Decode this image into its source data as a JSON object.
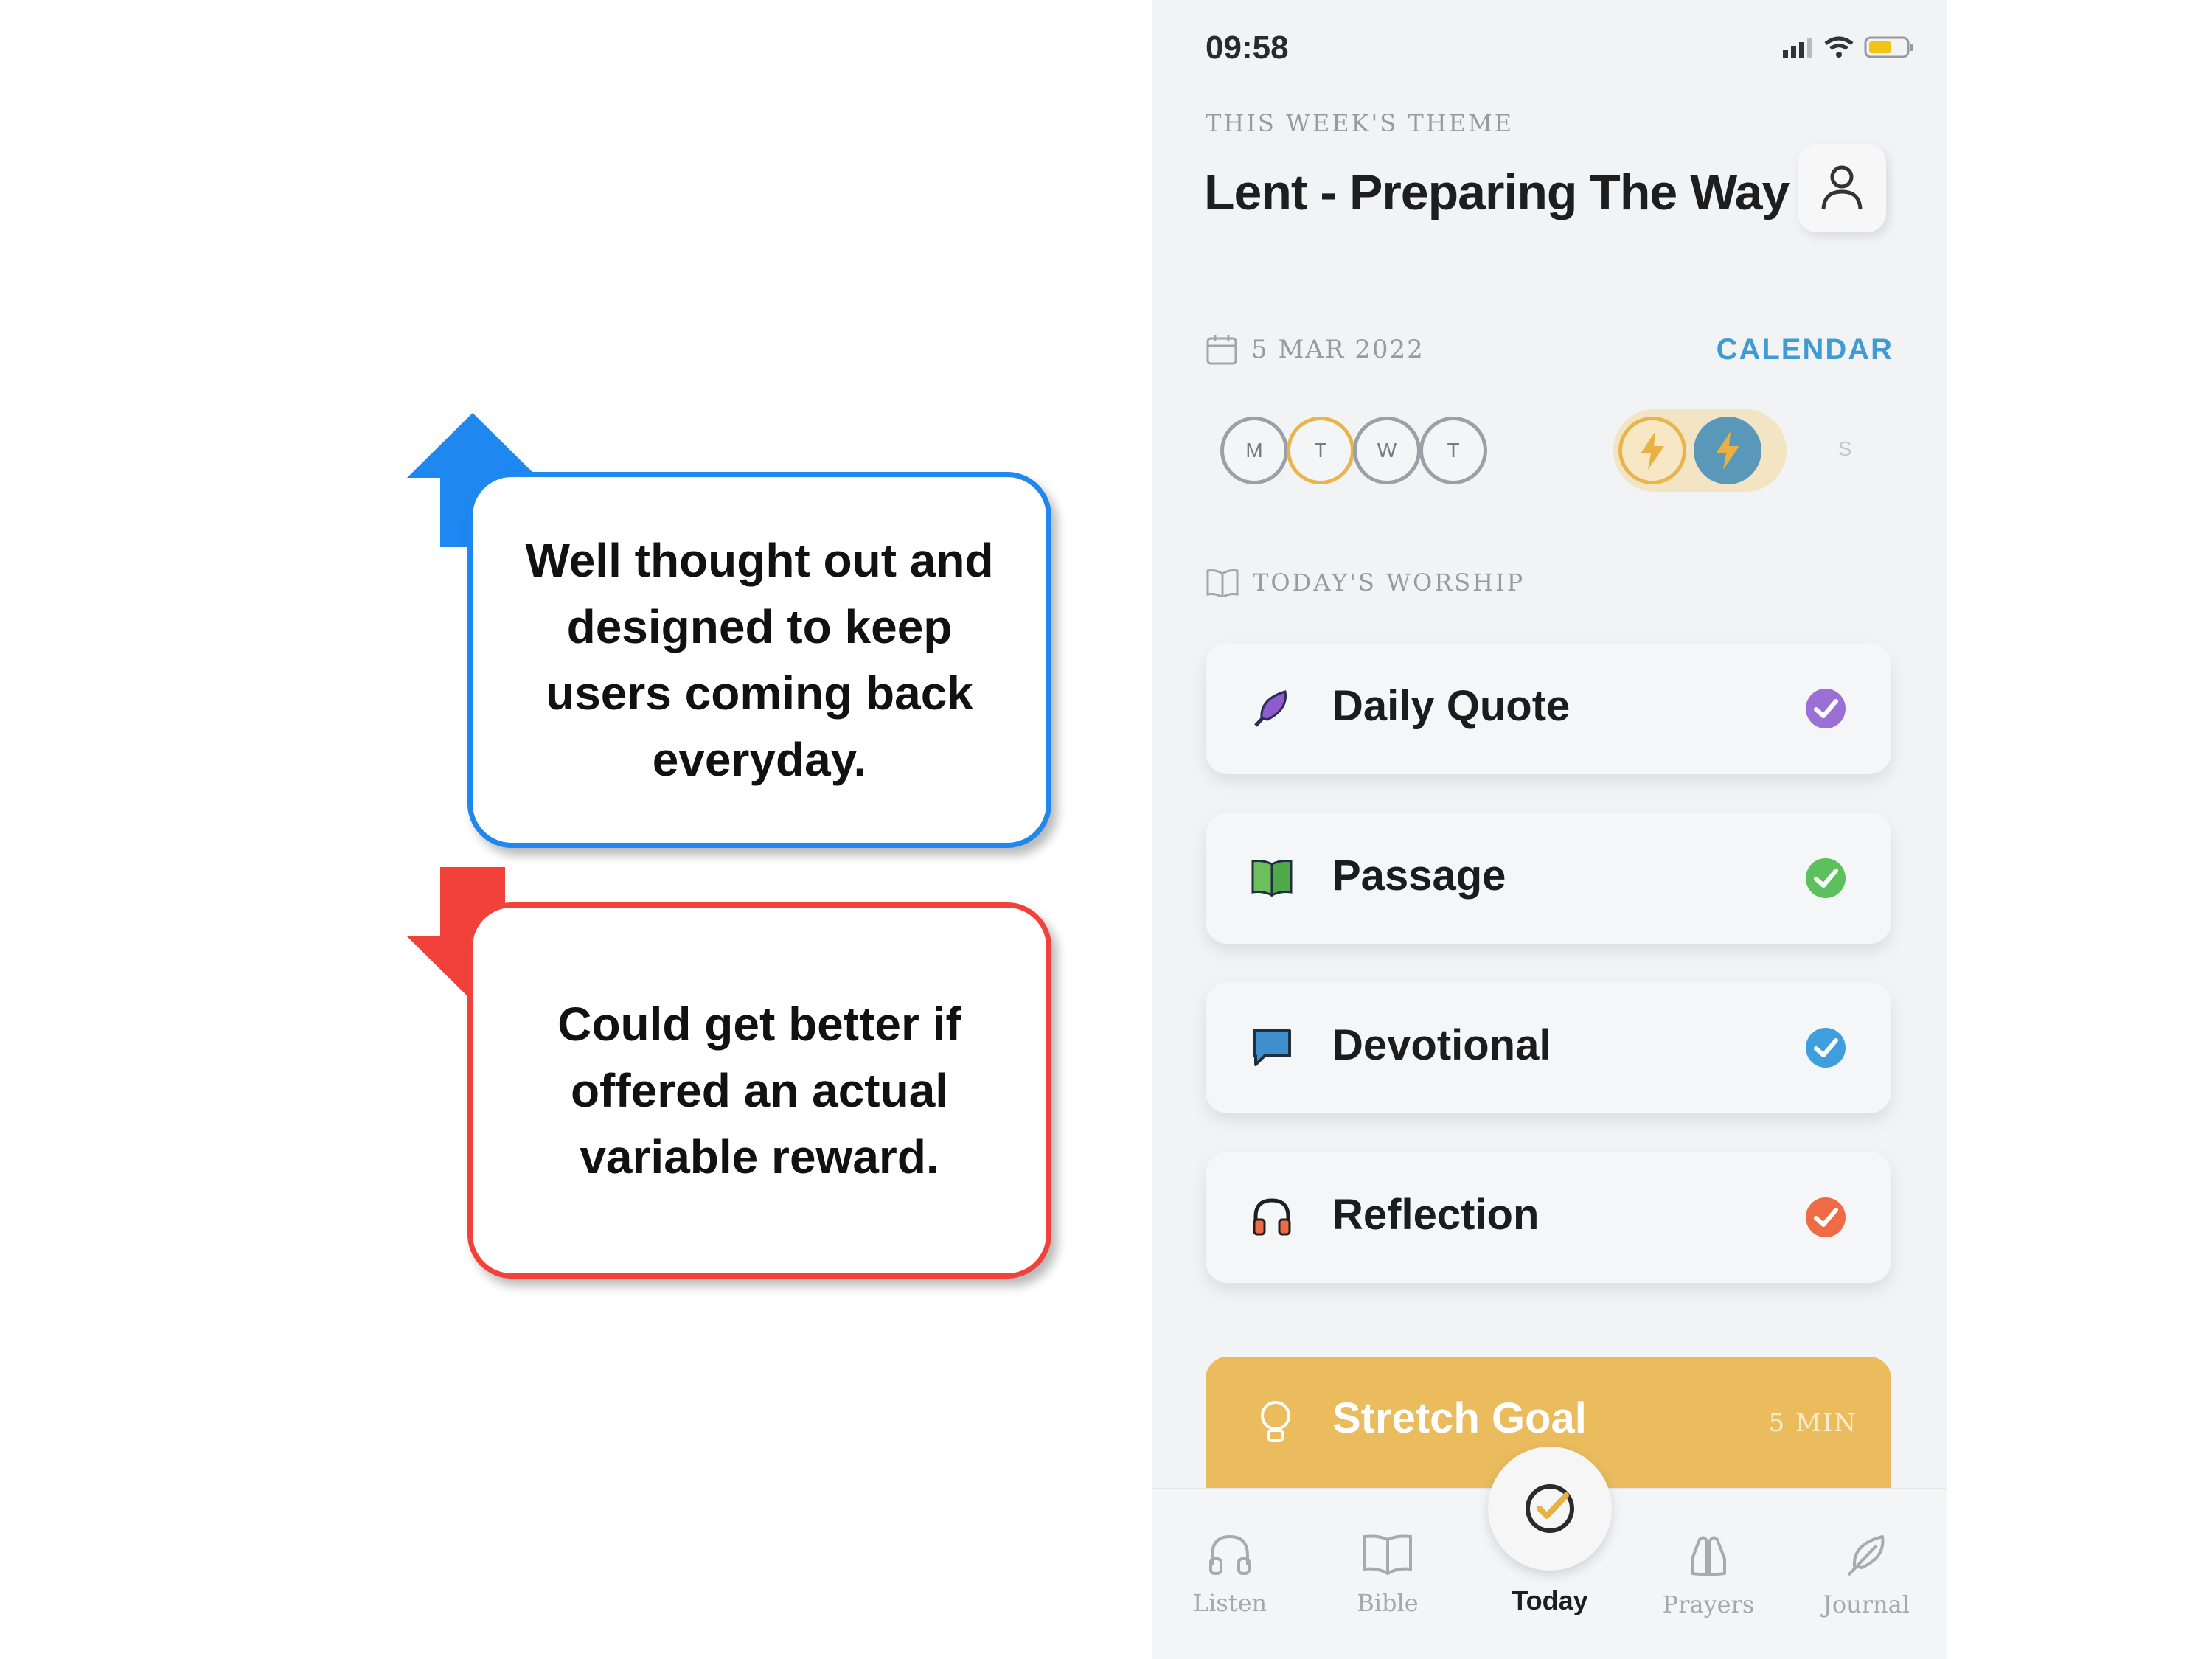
{
  "annotations": {
    "positive_text": "Well thought out and designed to keep users coming back everyday.",
    "negative_text": "Could get better if offered an actual variable reward.",
    "positive_color": "#1e87f0",
    "negative_color": "#f2413a"
  },
  "status_bar": {
    "time": "09:58",
    "icons": [
      "signal-icon",
      "wifi-icon",
      "battery-icon"
    ]
  },
  "header": {
    "theme_label": "THIS WEEK'S THEME",
    "theme_title": "Lent - Preparing The Way",
    "profile_icon": "user-icon"
  },
  "date": {
    "text": "5 MAR 2022",
    "calendar_link": "CALENDAR",
    "accent": "#3e9bd3"
  },
  "week_days": [
    {
      "letter": "M",
      "state": "empty"
    },
    {
      "letter": "T",
      "state": "partial"
    },
    {
      "letter": "W",
      "state": "empty"
    },
    {
      "letter": "T",
      "state": "empty"
    },
    {
      "letter": "",
      "state": "streak-bolt"
    },
    {
      "letter": "",
      "state": "today-bolt"
    },
    {
      "letter": "S",
      "state": "future"
    }
  ],
  "worship": {
    "section_label": "TODAY'S WORSHIP",
    "items": [
      {
        "label": "Daily Quote",
        "icon": "feather-icon",
        "check_color": "#9a6fd6"
      },
      {
        "label": "Passage",
        "icon": "book-icon",
        "check_color": "#5cc05c"
      },
      {
        "label": "Devotional",
        "icon": "chat-bubble-icon",
        "check_color": "#3f9fde"
      },
      {
        "label": "Reflection",
        "icon": "headphones-icon",
        "check_color": "#ee6b46"
      }
    ]
  },
  "stretch_goal": {
    "label": "Stretch Goal",
    "duration": "5 MIN",
    "icon": "lightbulb-icon",
    "color": "#ebbc5e"
  },
  "tabbar": {
    "tabs": [
      {
        "label": "Listen",
        "icon": "headphones-icon"
      },
      {
        "label": "Bible",
        "icon": "book-icon"
      },
      {
        "label": "Today",
        "icon": "check-circle-icon",
        "active": true
      },
      {
        "label": "Prayers",
        "icon": "praying-hands-icon"
      },
      {
        "label": "Journal",
        "icon": "feather-icon"
      }
    ]
  }
}
